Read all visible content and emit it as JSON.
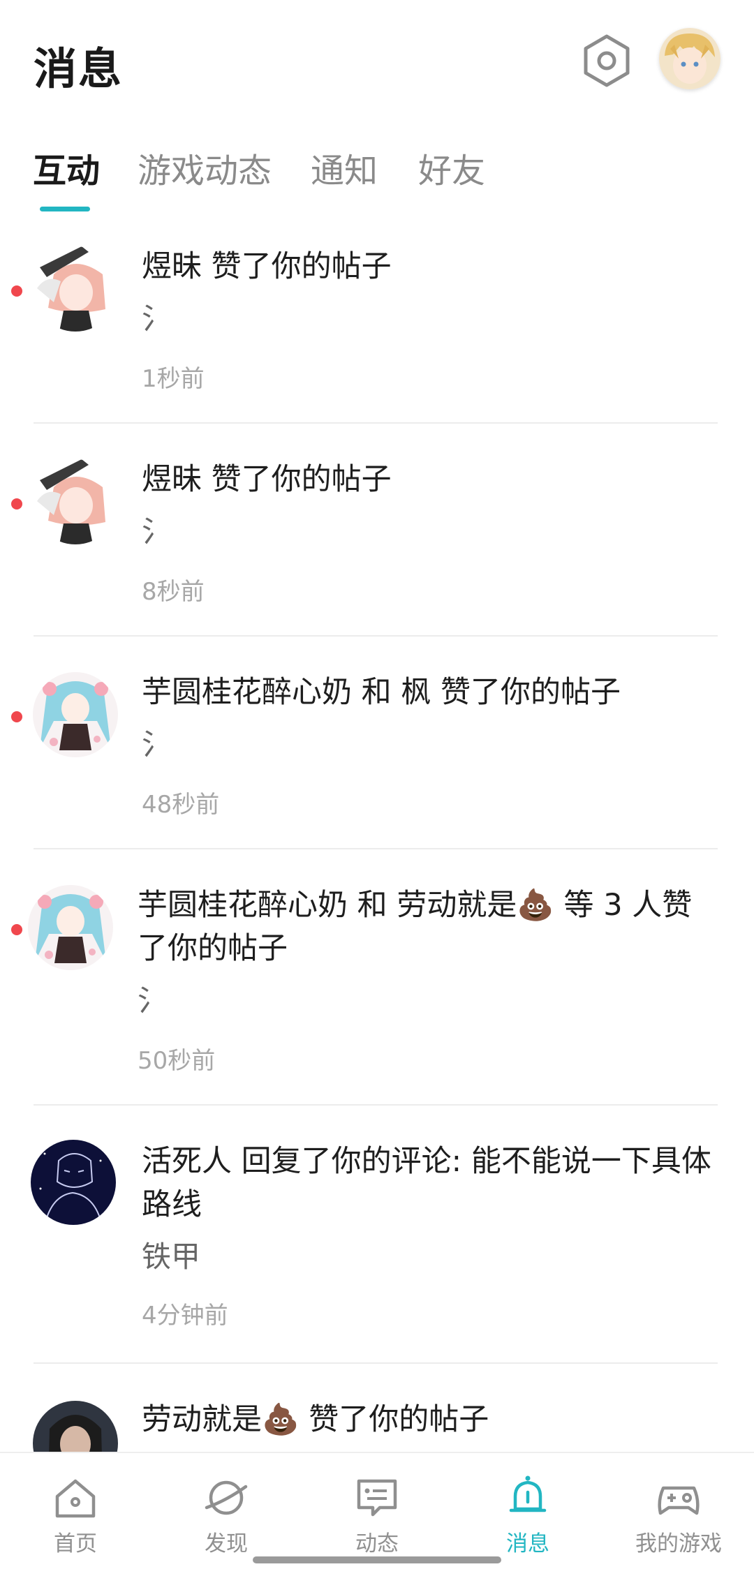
{
  "header": {
    "title": "消息",
    "settings_icon": "gear-icon",
    "avatar_icon": "user-avatar"
  },
  "tabs": [
    {
      "label": "互动",
      "active": true
    },
    {
      "label": "游戏动态",
      "active": false
    },
    {
      "label": "通知",
      "active": false
    },
    {
      "label": "好友",
      "active": false
    }
  ],
  "messages": [
    {
      "title": "煜昧 赞了你的帖子",
      "subtitle": "氵",
      "time": "1秒前",
      "unread": true
    },
    {
      "title": "煜昧 赞了你的帖子",
      "subtitle": "氵",
      "time": "8秒前",
      "unread": true
    },
    {
      "title": "芋圆桂花醉心奶 和 枫 赞了你的帖子",
      "subtitle": "氵",
      "time": "48秒前",
      "unread": true
    },
    {
      "title": "芋圆桂花醉心奶 和 劳动就是💩 等 3 人赞了你的帖子",
      "subtitle": "氵",
      "time": "50秒前",
      "unread": true
    },
    {
      "title": "活死人 回复了你的评论: 能不能说一下具体路线",
      "subtitle": "铁甲",
      "time": "4分钟前",
      "unread": false
    },
    {
      "title": "劳动就是💩 赞了你的帖子",
      "subtitle": "",
      "time": "",
      "unread": false
    }
  ],
  "bottom_nav": [
    {
      "label": "首页",
      "icon": "home-icon",
      "active": false
    },
    {
      "label": "发现",
      "icon": "discover-planet-icon",
      "active": false
    },
    {
      "label": "动态",
      "icon": "feed-chat-icon",
      "active": false
    },
    {
      "label": "消息",
      "icon": "bell-icon",
      "active": true
    },
    {
      "label": "我的游戏",
      "icon": "gamepad-icon",
      "active": false
    }
  ],
  "colors": {
    "accent": "#22b6c2",
    "unread": "#f0474d",
    "text_primary": "#1e1e1e",
    "text_secondary": "#a7a7a7"
  }
}
